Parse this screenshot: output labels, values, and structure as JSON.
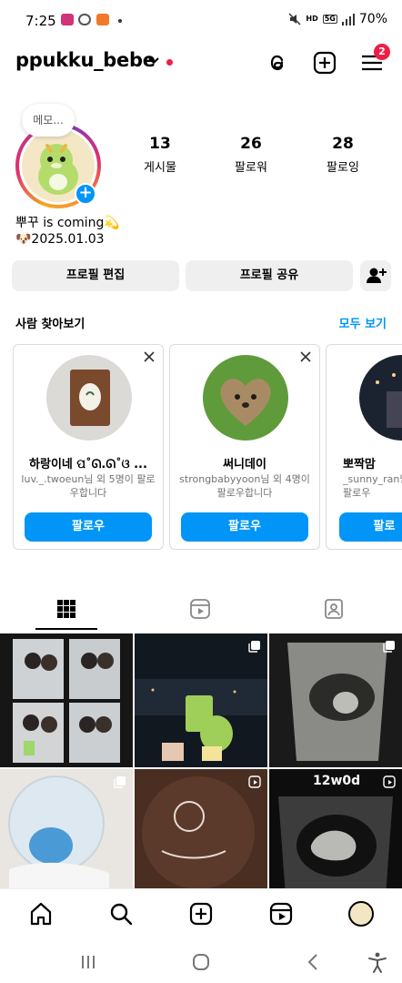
{
  "status_bar": {
    "time": "7:25",
    "battery": "70%",
    "network_badge": "5G",
    "hd_label": "HD"
  },
  "header": {
    "username": "ppukku_bebe",
    "notification_count": "2"
  },
  "profile": {
    "note": "메모...",
    "stats": [
      {
        "value": "13",
        "label": "게시물"
      },
      {
        "value": "26",
        "label": "팔로워"
      },
      {
        "value": "28",
        "label": "팔로잉"
      }
    ],
    "bio_line1": "뿌꾸 is coming💫",
    "bio_line2": "🐶2025.01.03"
  },
  "actions": {
    "edit_profile": "프로필 편집",
    "share_profile": "프로필 공유"
  },
  "discover": {
    "title": "사람 찾아보기",
    "see_all": "모두 보기",
    "cards": [
      {
        "name": "하랑이네 ପ˚ᘏ.ᘏ˚ଓ ...",
        "sub": "luv._.twoeun님 외 5명이 팔로우합니다",
        "button": "팔로우"
      },
      {
        "name": "써니데이",
        "sub": "strongbabyyoon님 외 4명이 팔로우합니다",
        "button": "팔로우"
      },
      {
        "name": "뽀짝맘",
        "sub": "_sunny_ran님 외 팔로우",
        "button": "팔로"
      }
    ]
  },
  "grid": {
    "post6_label": "12w0d"
  },
  "colors": {
    "accent_blue": "#0095f6",
    "badge_red": "#ed1f48",
    "button_gray": "#efefef"
  }
}
